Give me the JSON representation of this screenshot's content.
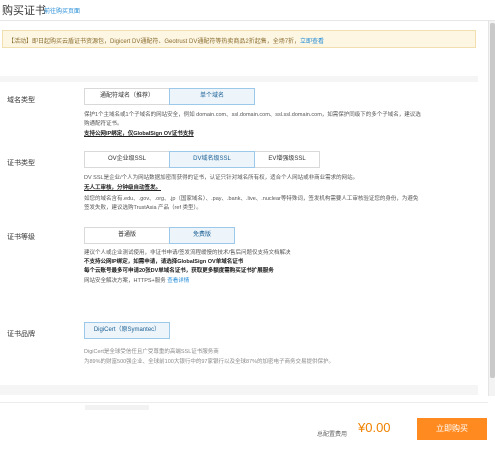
{
  "header": {
    "title": "购买证书",
    "link": "前往购买页面"
  },
  "notice": {
    "text": "【活动】即日起购买云盾证书资源包，Digicert DV通配符、Geotrust DV通配符等热卖商品2折起售，全场7折，",
    "more": "立即查看"
  },
  "domain_type": {
    "label": "域名类型",
    "options": [
      "通配符域名（推荐）",
      "单个域名"
    ],
    "selected": "单个域名",
    "desc_1": "保护1个主域名或1个子域名的网站安全，例如 domain.com、ssl.domain.com、ssl.ssl.domain.com，如需保护同级下的多个子域名，建议选",
    "desc_2": "购通配符证书。",
    "desc_3": "支持公网IP绑定，仅GlobalSign OV证书支持"
  },
  "cert_type": {
    "label": "证书类型",
    "options": [
      "OV企业级SSL",
      "DV域名级SSL",
      "EV增强级SSL"
    ],
    "selected": "DV域名级SSL",
    "desc_1": "DV SSL是企业/个人为网站数据加密而获得的证书，认证只针对域名所有权，适合个人网站或非商业需求的网站。",
    "desc_2": "无人工审核，分钟级自动签发。",
    "desc_3": "如您的域名含有.edu、.gov、.org、.jp（国家域名）、.pay、.bank、.live、.nuclear等特殊词，签发机构需要人工审核验证您的身份，为避免",
    "desc_4": "签发失败，建议选购TrustAsia 产品（ref 类型）。"
  },
  "cert_level": {
    "label": "证书等级",
    "options": [
      "普通版",
      "免费版"
    ],
    "selected": "免费版",
    "desc_1": "建议个人或企业测试使用，非证书申请/签发流程缓慢的技术/售后问题仅支持文档解决",
    "desc_2": "不支持公网IP绑定，如需申请，请选择GlobalSign OV单域名证书",
    "desc_3": "每个云账号最多可申请20张DV单域名证书，获取更多额度需购买证书扩展服务",
    "desc_4": "网站安全解决方案，HTTPS+服务",
    "desc_4_link": "查看详情"
  },
  "cert_brand": {
    "label": "证书品牌",
    "options": [
      "DigiCert（原Symantec）"
    ],
    "selected": "DigiCert（原Symantec）",
    "desc_1": "DigiCert是全球受信任且广受尊重的高端SSL证书服务商",
    "desc_2": "为89%的财富500强企业、全球前100大银行中的97家银行以及全球87%的加密电子商务交易提供保护。"
  },
  "footer": {
    "total_label": "总配置费用",
    "total_price": "¥0.00",
    "buy_label": "立即购买"
  },
  "colors": {
    "accent_blue": "#1f8ad6",
    "selected_bg": "#edf5fb",
    "price_orange": "#f08200",
    "buy_button": "#ff8a1f",
    "notice_bg": "#fdf6e3"
  }
}
